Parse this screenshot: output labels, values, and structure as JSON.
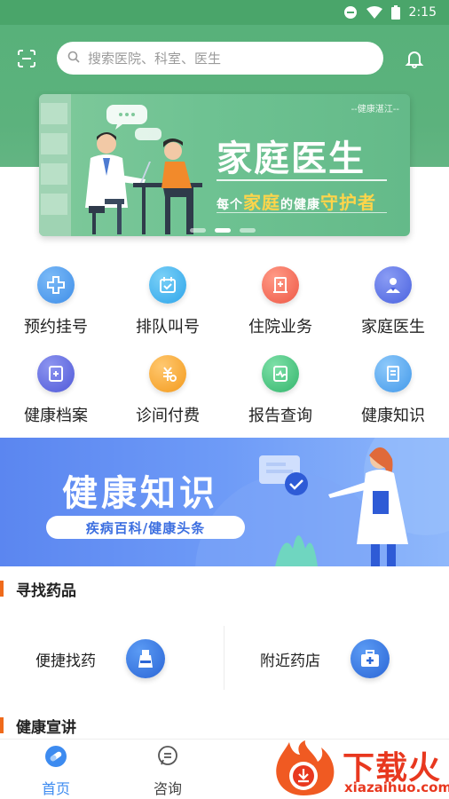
{
  "status_bar": {
    "time": "2:15"
  },
  "header": {
    "search_placeholder": "搜索医院、科室、医生"
  },
  "hero_banner": {
    "tag": "--健康湛江--",
    "title": "家庭医生",
    "slogan_parts": [
      "每个",
      "家庭",
      "的",
      "健康",
      "守护者"
    ],
    "slides": 3,
    "active_slide": 2
  },
  "services": [
    {
      "label": "预约挂号",
      "icon": "hospital-cross-icon",
      "color": "#4f9cf0"
    },
    {
      "label": "排队叫号",
      "icon": "calendar-check-icon",
      "color": "#3fb0ef"
    },
    {
      "label": "住院业务",
      "icon": "hospital-bed-icon",
      "color": "#f26a5a"
    },
    {
      "label": "家庭医生",
      "icon": "doctor-icon",
      "color": "#5872e8"
    },
    {
      "label": "健康档案",
      "icon": "health-record-icon",
      "color": "#6270e0"
    },
    {
      "label": "诊间付费",
      "icon": "payment-icon",
      "color": "#f5a623"
    },
    {
      "label": "报告查询",
      "icon": "report-icon",
      "color": "#4cc180"
    },
    {
      "label": "健康知识",
      "icon": "knowledge-book-icon",
      "color": "#58a8f0"
    }
  ],
  "knowledge_banner": {
    "title": "健康知识",
    "subtitle": "疾病百科/健康头条"
  },
  "find_drugs": {
    "title": "寻找药品",
    "items": [
      {
        "label": "便捷找药",
        "icon": "medicine-bottle-icon"
      },
      {
        "label": "附近药店",
        "icon": "medical-kit-icon"
      }
    ]
  },
  "health_lecture": {
    "title": "健康宣讲"
  },
  "bottom_nav": [
    {
      "label": "首页",
      "icon": "home-pill-icon",
      "active": true
    },
    {
      "label": "咨询",
      "icon": "chat-icon",
      "active": false
    }
  ],
  "watermark": {
    "brand": "下载火",
    "url": "xiazaihuo.com"
  },
  "colors": {
    "primary_green": "#58b17a",
    "accent_orange": "#ef6a1b",
    "nav_active": "#3d8bf0"
  }
}
